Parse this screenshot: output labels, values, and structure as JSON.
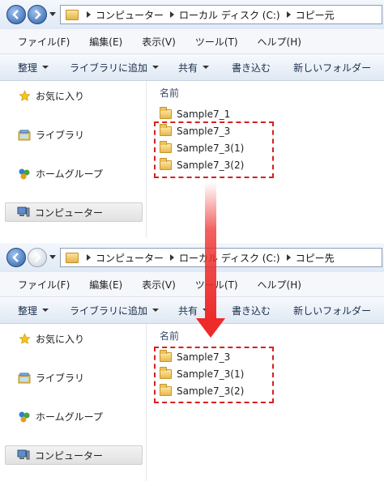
{
  "before": {
    "breadcrumb": [
      "コンピューター",
      "ローカル ディスク (C:)",
      "コピー元"
    ],
    "menu": [
      "ファイル(F)",
      "編集(E)",
      "表示(V)",
      "ツール(T)",
      "ヘルプ(H)"
    ],
    "toolbar": [
      "整理",
      "ライブラリに追加",
      "共有",
      "書き込む",
      "新しいフォルダー"
    ],
    "sidebar": [
      "お気に入り",
      "ライブラリ",
      "ホームグループ",
      "コンピューター"
    ],
    "column_header": "名前",
    "files": [
      "Sample7_1",
      "Sample7_3",
      "Sample7_3(1)",
      "Sample7_3(2)"
    ]
  },
  "after": {
    "breadcrumb": [
      "コンピューター",
      "ローカル ディスク (C:)",
      "コピー先"
    ],
    "menu": [
      "ファイル(F)",
      "編集(E)",
      "表示(V)",
      "ツール(T)",
      "ヘルプ(H)"
    ],
    "toolbar": [
      "整理",
      "ライブラリに追加",
      "共有",
      "書き込む",
      "新しいフォルダー"
    ],
    "sidebar": [
      "お気に入り",
      "ライブラリ",
      "ホームグループ",
      "コンピューター"
    ],
    "column_header": "名前",
    "files": [
      "Sample7_3",
      "Sample7_3(1)",
      "Sample7_3(2)"
    ]
  },
  "colors": {
    "highlight": "#d62020",
    "arrow": "#ee2a2a"
  },
  "icons": {
    "back": "back-arrow-icon",
    "forward": "forward-arrow-icon",
    "favorites": "star-icon",
    "libraries": "library-icon",
    "homegroup": "homegroup-icon",
    "computer": "computer-icon",
    "folder": "folder-icon"
  }
}
